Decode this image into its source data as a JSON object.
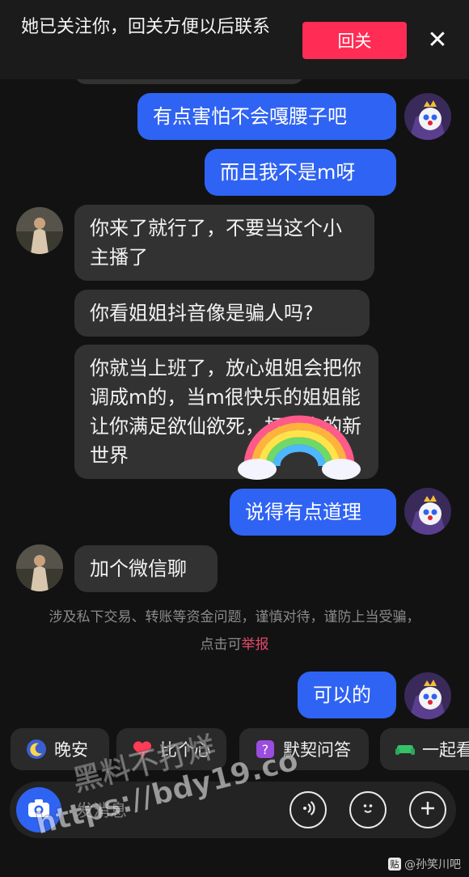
{
  "banner": {
    "text": "她已关注你，回关方便以后联系",
    "follow_back_label": "回关",
    "close_glyph": "✕"
  },
  "messages": [
    {
      "side": "out",
      "text": "有点害怕不会嘎腰子吧"
    },
    {
      "side": "out",
      "text": "而且我不是m呀"
    },
    {
      "side": "in",
      "text": "你来了就行了，不要当这个小主播了"
    },
    {
      "side": "in",
      "text": "你看姐姐抖音像是骗人吗?"
    },
    {
      "side": "in",
      "text": "你就当上班了，放心姐姐会把你调成m的，当m很快乐的姐姐能让你满足欲仙欲死，打开你的新世界"
    },
    {
      "side": "out",
      "text": "说得有点道理"
    },
    {
      "side": "in",
      "text": "加个微信聊"
    },
    {
      "side": "out",
      "text": "可以的"
    }
  ],
  "safety_notice": {
    "text": "涉及私下交易、转账等资金问题，谨慎对待，谨防上当受骗，点击可",
    "report_link": "举报"
  },
  "quick_replies": [
    {
      "label": "晚安",
      "icon": "moon-icon"
    },
    {
      "label": "比个心",
      "icon": "heart-icon"
    },
    {
      "label": "默契问答",
      "icon": "question-icon"
    },
    {
      "label": "一起看",
      "icon": "sofa-icon"
    }
  ],
  "input": {
    "placeholder": "发消息"
  },
  "watermarks": [
    "黑料不打烊",
    "https://bdy19.co"
  ],
  "credit": {
    "badge": "贴",
    "text": "@孙笑川吧"
  },
  "colors": {
    "background": "#121212",
    "outgoing_bubble": "#2f63f3",
    "incoming_bubble": "#323232",
    "follow_back": "#ff2c55",
    "report_link": "#e24b6b"
  }
}
